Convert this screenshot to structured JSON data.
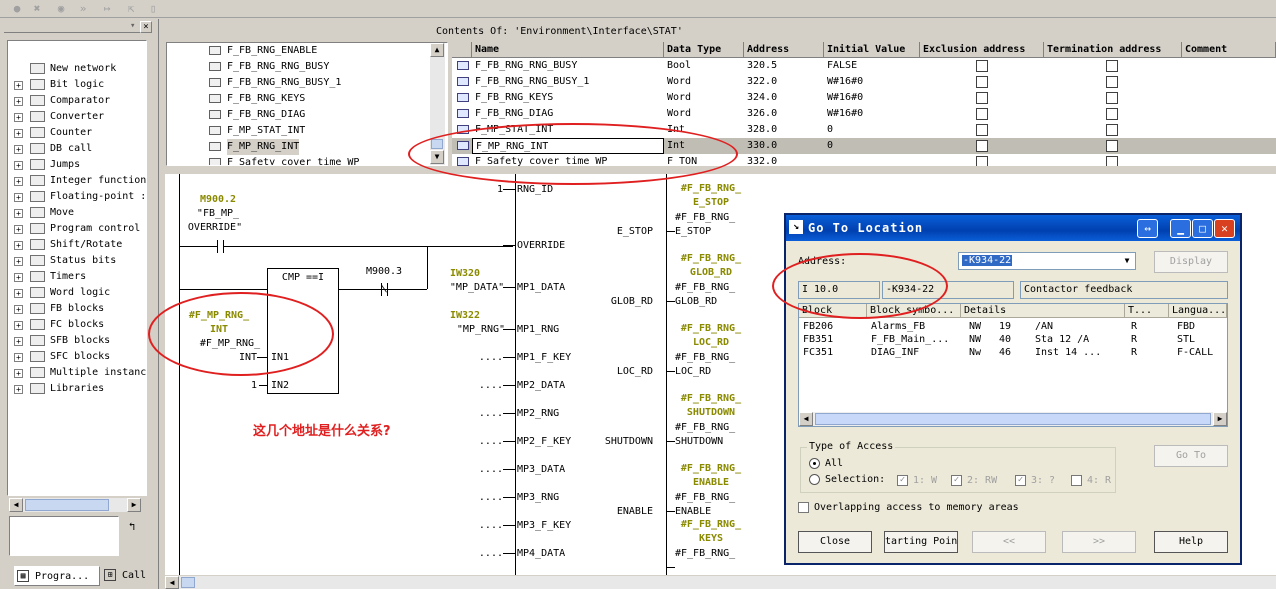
{
  "header": {
    "contents_of": "Contents Of: 'Environment\\Interface\\STAT'"
  },
  "catalog": {
    "items": [
      {
        "label": "New network",
        "icon": "new-network-icon",
        "expandable": false
      },
      {
        "label": "Bit logic",
        "icon": "bit-logic-icon",
        "expandable": true
      },
      {
        "label": "Comparator",
        "icon": "comparator-icon",
        "expandable": true
      },
      {
        "label": "Converter",
        "icon": "converter-icon",
        "expandable": true
      },
      {
        "label": "Counter",
        "icon": "counter-icon",
        "expandable": true
      },
      {
        "label": "DB call",
        "icon": "db-call-icon",
        "expandable": true
      },
      {
        "label": "Jumps",
        "icon": "jumps-icon",
        "expandable": true
      },
      {
        "label": "Integer function",
        "icon": "integer-function-icon",
        "expandable": true
      },
      {
        "label": "Floating-point :",
        "icon": "floating-point-icon",
        "expandable": true
      },
      {
        "label": "Move",
        "icon": "move-icon",
        "expandable": true
      },
      {
        "label": "Program control",
        "icon": "program-control-icon",
        "expandable": true
      },
      {
        "label": "Shift/Rotate",
        "icon": "shift-rotate-icon",
        "expandable": true
      },
      {
        "label": "Status bits",
        "icon": "status-bits-icon",
        "expandable": true
      },
      {
        "label": "Timers",
        "icon": "timers-icon",
        "expandable": true
      },
      {
        "label": "Word logic",
        "icon": "word-logic-icon",
        "expandable": true
      },
      {
        "label": "FB blocks",
        "icon": "fb-blocks-icon",
        "expandable": true
      },
      {
        "label": "FC blocks",
        "icon": "fc-blocks-icon",
        "expandable": true
      },
      {
        "label": "SFB blocks",
        "icon": "sfb-blocks-icon",
        "expandable": true
      },
      {
        "label": "SFC blocks",
        "icon": "sfc-blocks-icon",
        "expandable": true
      },
      {
        "label": "Multiple instanc",
        "icon": "multiple-instance-icon",
        "expandable": true
      },
      {
        "label": "Libraries",
        "icon": "libraries-icon",
        "expandable": true
      }
    ]
  },
  "bottom_tabs": [
    {
      "label": "Progra..."
    },
    {
      "label": "Call"
    }
  ],
  "tree": {
    "items": [
      {
        "label": "F_FB_RNG_ENABLE"
      },
      {
        "label": "F_FB_RNG_RNG_BUSY"
      },
      {
        "label": "F_FB_RNG_RNG_BUSY_1"
      },
      {
        "label": "F_FB_RNG_KEYS"
      },
      {
        "label": "F_FB_RNG_DIAG"
      },
      {
        "label": "F_MP_STAT_INT"
      },
      {
        "label": "F_MP_RNG_INT"
      },
      {
        "label": "F_Safety_cover_time_WP"
      }
    ]
  },
  "table": {
    "columns": [
      "Name",
      "Data Type",
      "Address",
      "Initial Value",
      "Exclusion address",
      "Termination address",
      "Comment"
    ],
    "rows": [
      {
        "name": "F_FB_RNG_RNG_BUSY",
        "type": "Bool",
        "address": "320.5",
        "initial": "FALSE"
      },
      {
        "name": "F_FB_RNG_RNG_BUSY_1",
        "type": "Word",
        "address": "322.0",
        "initial": "W#16#0"
      },
      {
        "name": "F_FB_RNG_KEYS",
        "type": "Word",
        "address": "324.0",
        "initial": "W#16#0"
      },
      {
        "name": "F_FB_RNG_DIAG",
        "type": "Word",
        "address": "326.0",
        "initial": "W#16#0"
      },
      {
        "name": "F_MP_STAT_INT",
        "type": "Int",
        "address": "328.0",
        "initial": "0"
      },
      {
        "name": "F_MP_RNG_INT",
        "type": "Int",
        "address": "330.0",
        "initial": "0"
      },
      {
        "name": "F_Safety_cover_time_WP",
        "type": "F_TON",
        "address": "332.0",
        "initial": ""
      }
    ]
  },
  "ladder": {
    "contact1_addr": "M900.2",
    "contact1_sym1": "\"FB_MP_",
    "contact1_sym2": "OVERRIDE\"",
    "cmp_label": "CMP ==I",
    "contact2_addr": "M900.3",
    "in1_var1": "#F_MP_RNG_",
    "in1_var2": "INT",
    "in1_var3": "#F_MP_RNG_",
    "in1_var4": "INT",
    "in1_pin": "IN1",
    "in2_val": "1",
    "in2_pin": "IN2",
    "annotation": "这几个地址是什么关系?",
    "block_inputs": [
      {
        "pre": "1",
        "pin": "RNG_ID"
      },
      {
        "pre": "",
        "pin": "OVERRIDE"
      },
      {
        "pre": "",
        "pin": "MP1_DATA"
      },
      {
        "pre": "",
        "pin": "MP1_RNG"
      },
      {
        "pre": "....",
        "pin": "MP1_F_KEY"
      },
      {
        "pre": "....",
        "pin": "MP2_DATA"
      },
      {
        "pre": "....",
        "pin": "MP2_RNG"
      },
      {
        "pre": "....",
        "pin": "MP2_F_KEY"
      },
      {
        "pre": "....",
        "pin": "MP3_DATA"
      },
      {
        "pre": "....",
        "pin": "MP3_RNG"
      },
      {
        "pre": "....",
        "pin": "MP3_F_KEY"
      },
      {
        "pre": "....",
        "pin": "MP4_DATA"
      }
    ],
    "iw320_addr": "IW320",
    "iw320_sym": "\"MP_DATA\"",
    "iw322_addr": "IW322",
    "iw322_sym": "\"MP_RNG\"",
    "block_outputs": [
      {
        "pin": "E_STOP",
        "out": "E_STOP",
        "olive1": "#F_FB_RNG_",
        "olive2": "E_STOP",
        "var": "#F_FB_RNG_"
      },
      {
        "pin": "GLOB_RD",
        "out": "GLOB_RD",
        "olive1": "#F_FB_RNG_",
        "olive2": "GLOB_RD",
        "var": "#F_FB_RNG_"
      },
      {
        "pin": "LOC_RD",
        "out": "LOC_RD",
        "olive1": "#F_FB_RNG_",
        "olive2": "LOC_RD",
        "var": "#F_FB_RNG_"
      },
      {
        "pin": "SHUTDOWN",
        "out": "SHUTDOWN",
        "olive1": "#F_FB_RNG_",
        "olive2": "SHUTDOWN",
        "var": "#F_FB_RNG_"
      },
      {
        "pin": "ENABLE",
        "out": "ENABLE",
        "olive1": "#F_FB_RNG_",
        "olive2": "ENABLE",
        "var": "#F_FB_RNG_"
      },
      {
        "pin": "",
        "out": "",
        "olive1": "#F_FB_RNG_",
        "olive2": "KEYS",
        "var": "#F_FB_RNG_"
      }
    ]
  },
  "dialog": {
    "title": "Go To Location",
    "address_label": "Address:",
    "address_value": "-K934-22",
    "display_btn": "Display",
    "info_addr": "I     10.0",
    "info_symbol": "-K934-22",
    "info_comment": "Contactor feedback",
    "columns": [
      "Block",
      "Block symbo...",
      "Details",
      "T...",
      "Langua..."
    ],
    "rows": [
      {
        "block": "FB206",
        "symbol": "Alarms_FB",
        "d1": "NW",
        "d2": "19",
        "d3": "/AN",
        "t": "R",
        "lang": "FBD"
      },
      {
        "block": "FB351",
        "symbol": "F_FB_Main_...",
        "d1": "NW",
        "d2": "40",
        "d3": "Sta   12    /A",
        "t": "R",
        "lang": "STL"
      },
      {
        "block": "FC351",
        "symbol": "DIAG_INF",
        "d1": "Nw",
        "d2": "46",
        "d3": "Inst   14 ...",
        "t": "R",
        "lang": "F-CALL"
      }
    ],
    "access_group": "Type of Access",
    "all_label": "All",
    "selection_label": "Selection:",
    "sel_opts": [
      "1: W",
      "2: RW",
      "3: ?",
      "4: R"
    ],
    "goto_btn": "Go To",
    "overlap_label": "Overlapping access to memory areas",
    "close_btn": "Close",
    "start_btn": "tarting Poin",
    "prev_btn": "<<",
    "next_btn": ">>",
    "help_btn": "Help"
  }
}
